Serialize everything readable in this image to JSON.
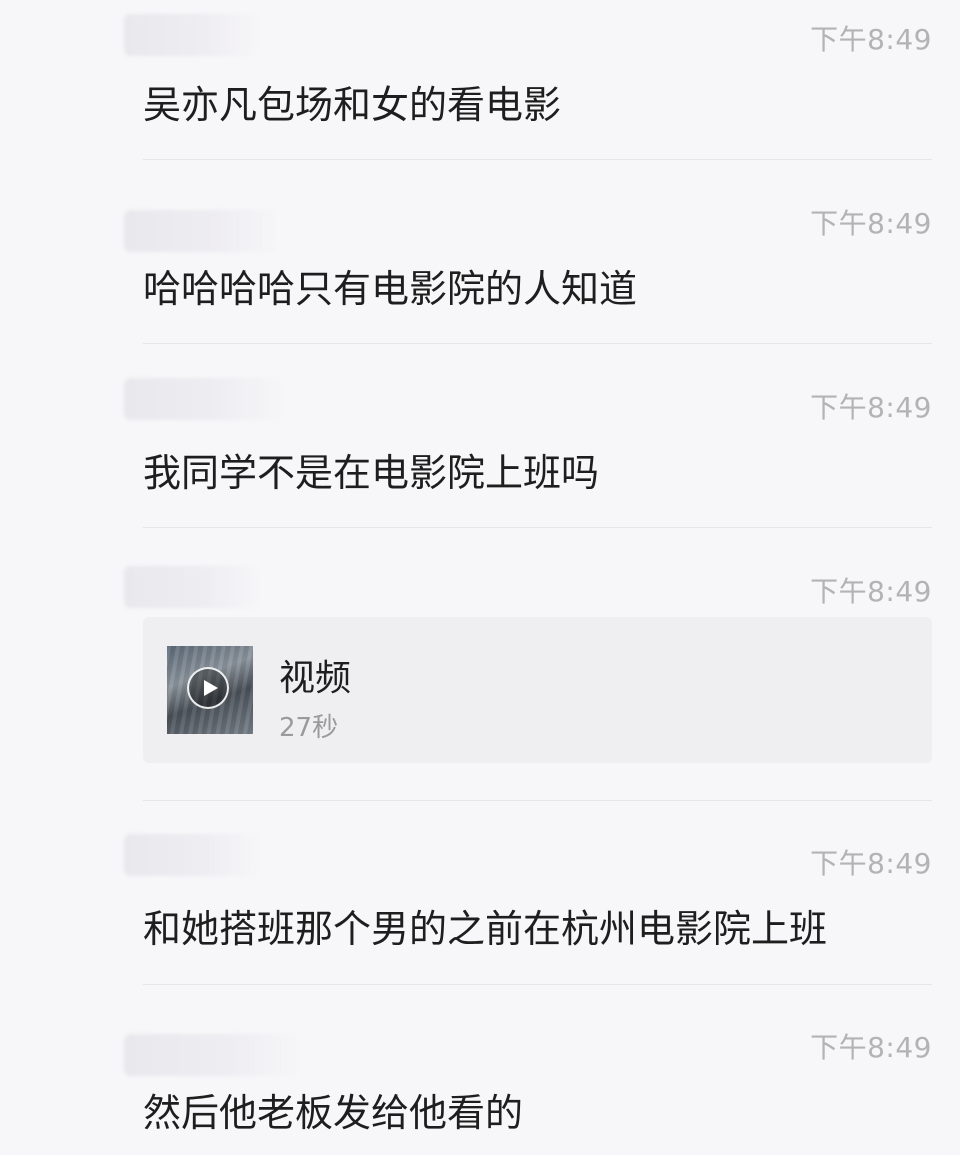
{
  "messages": [
    {
      "time": "下午8:49",
      "text": "吴亦凡包场和女的看电影"
    },
    {
      "time": "下午8:49",
      "text": "哈哈哈哈只有电影院的人知道"
    },
    {
      "time": "下午8:49",
      "text": "我同学不是在电影院上班吗"
    },
    {
      "time": "下午8:49",
      "video": {
        "title": "视频",
        "duration": "27秒",
        "icon": "play-icon"
      }
    },
    {
      "time": "下午8:49",
      "text": "和她搭班那个男的之前在杭州电影院上班"
    },
    {
      "time": "下午8:49",
      "text": "然后他老板发给他看的"
    }
  ]
}
